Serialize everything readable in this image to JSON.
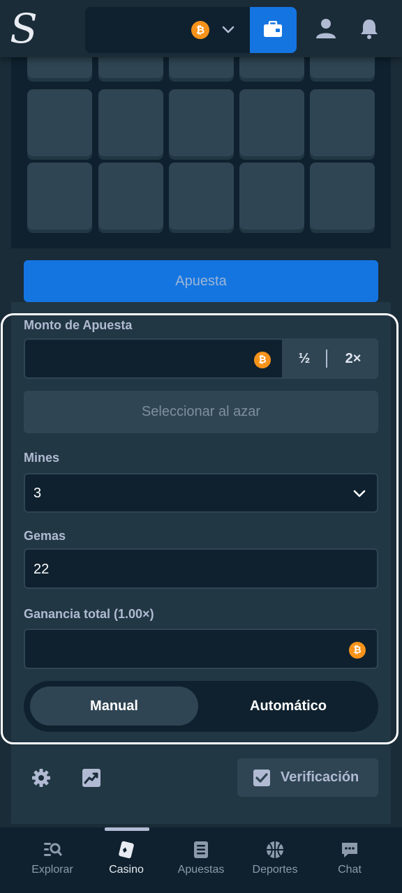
{
  "header": {
    "logo": "S",
    "currency_icon": "bitcoin-icon",
    "accent_color": "#1475e1"
  },
  "game": {
    "bet_button_label": "Apuesta"
  },
  "form": {
    "bet_amount_label": "Monto de Apuesta",
    "half_label": "½",
    "double_label": "2×",
    "random_button_label": "Seleccionar al azar",
    "mines_label": "Mines",
    "mines_value": "3",
    "gems_label": "Gemas",
    "gems_value": "22",
    "profit_label": "Ganancia total (1.00×)",
    "mode_manual": "Manual",
    "mode_auto": "Automático",
    "active_mode": "Manual"
  },
  "footer": {
    "verify_label": "Verificación"
  },
  "bottom_nav": {
    "items": [
      {
        "label": "Explorar",
        "icon": "explore-icon"
      },
      {
        "label": "Casino",
        "icon": "casino-cards-icon",
        "active": true
      },
      {
        "label": "Apuestas",
        "icon": "bets-list-icon"
      },
      {
        "label": "Deportes",
        "icon": "basketball-icon"
      },
      {
        "label": "Chat",
        "icon": "chat-icon"
      }
    ]
  }
}
